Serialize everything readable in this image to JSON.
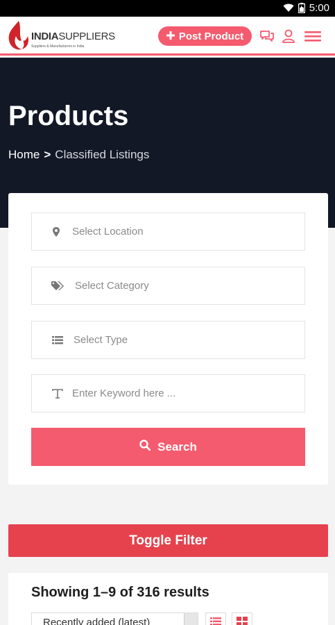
{
  "status_bar": {
    "time": "5:00"
  },
  "header": {
    "logo": {
      "brand_bold": "INDIA",
      "brand_light": "SUPPLIERS",
      "tagline": "Suppliers & Manufacturers in India"
    },
    "post_button_label": "Post Product",
    "icons": [
      "chat-icon",
      "user-icon",
      "menu-icon"
    ],
    "accent_color": "#f45b6e"
  },
  "hero": {
    "title": "Products",
    "breadcrumb": {
      "home": "Home",
      "separator": ">",
      "current": "Classified Listings"
    },
    "background_color": "#121826"
  },
  "filters": {
    "location_placeholder": "Select Location",
    "category_placeholder": "Select Category",
    "type_placeholder": "Select Type",
    "keyword_placeholder": "Enter Keyword here ...",
    "search_label": "Search"
  },
  "toggle_filter_label": "Toggle Filter",
  "results": {
    "summary": "Showing 1–9 of 316 results",
    "sort_selected": "Recently added (latest)"
  }
}
